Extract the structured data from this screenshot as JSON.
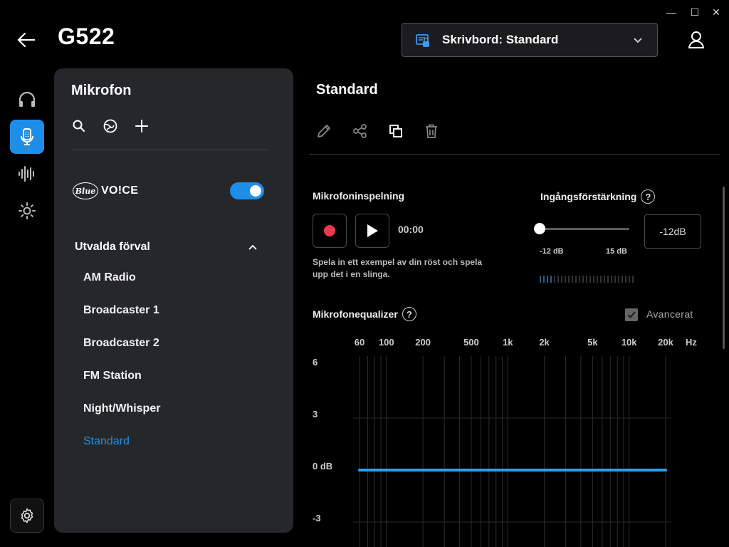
{
  "window": {
    "minimize": "—",
    "maximize": "☐",
    "close": "✕"
  },
  "header": {
    "device": "G522",
    "profile": {
      "label": "Skrivbord: Standard",
      "icon": "desktop-profile-icon"
    },
    "user_icon": "user-icon",
    "back_icon": "back-arrow-icon"
  },
  "rail": [
    {
      "name": "headphones",
      "icon": "headphones-icon",
      "active": false
    },
    {
      "name": "microphone",
      "icon": "microphone-icon",
      "active": true
    },
    {
      "name": "equalizer",
      "icon": "equalizer-icon",
      "active": false
    },
    {
      "name": "lighting",
      "icon": "lighting-icon",
      "active": false
    }
  ],
  "panel": {
    "title": "Mikrofon",
    "tools": [
      "search-icon",
      "globe-icon",
      "add-icon"
    ],
    "blue_voice": {
      "logo": "Blue",
      "word": "VO!CE",
      "enabled": true
    },
    "group": "Utvalda förval",
    "presets": [
      "AM Radio",
      "Broadcaster 1",
      "Broadcaster 2",
      "FM Station",
      "Night/Whisper",
      "Standard"
    ],
    "selected": "Standard"
  },
  "content": {
    "title": "Standard",
    "tools": [
      "edit-icon",
      "share-icon",
      "duplicate-icon",
      "delete-icon"
    ],
    "recording": {
      "label": "Mikrofoninspelning",
      "time": "00:00",
      "hint": "Spela in ett exempel av din röst och spela upp det i en slinga."
    },
    "gain": {
      "label": "Ingångsförstärkning",
      "min_label": "-12 dB",
      "max_label": "15 dB",
      "value": "-12dB",
      "value_db": -12,
      "min_db": -12,
      "max_db": 15
    },
    "eq": {
      "label": "Mikrofonequalizer",
      "advanced_label": "Avancerat",
      "advanced_checked": true,
      "freq_labels": [
        "60",
        "100",
        "200",
        "500",
        "1k",
        "2k",
        "5k",
        "10k",
        "20k",
        "Hz"
      ],
      "db_labels": [
        "6",
        "3",
        "0 dB",
        "-3"
      ],
      "curve_db": 0
    },
    "help": "?"
  },
  "colors": {
    "accent": "#1e8fe8",
    "record": "#f0384c",
    "panel": "#25272b"
  }
}
